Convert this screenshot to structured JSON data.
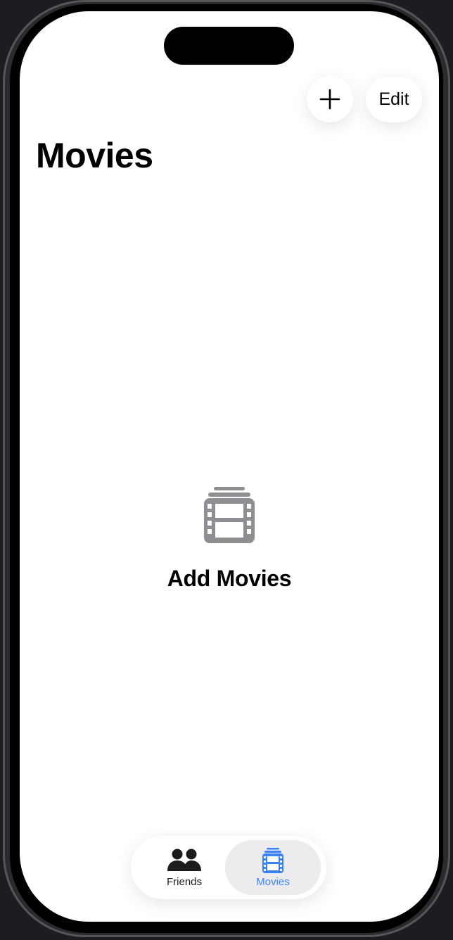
{
  "navigation": {
    "title": "Movies",
    "add_icon": "plus-icon",
    "edit_label": "Edit"
  },
  "empty_state": {
    "icon": "film-stack-icon",
    "label": "Add Movies"
  },
  "tab_bar": {
    "items": [
      {
        "label": "Friends",
        "icon": "people-icon",
        "selected": false
      },
      {
        "label": "Movies",
        "icon": "film-stack-icon",
        "selected": true
      }
    ],
    "accent_color": "#3a82f7"
  }
}
